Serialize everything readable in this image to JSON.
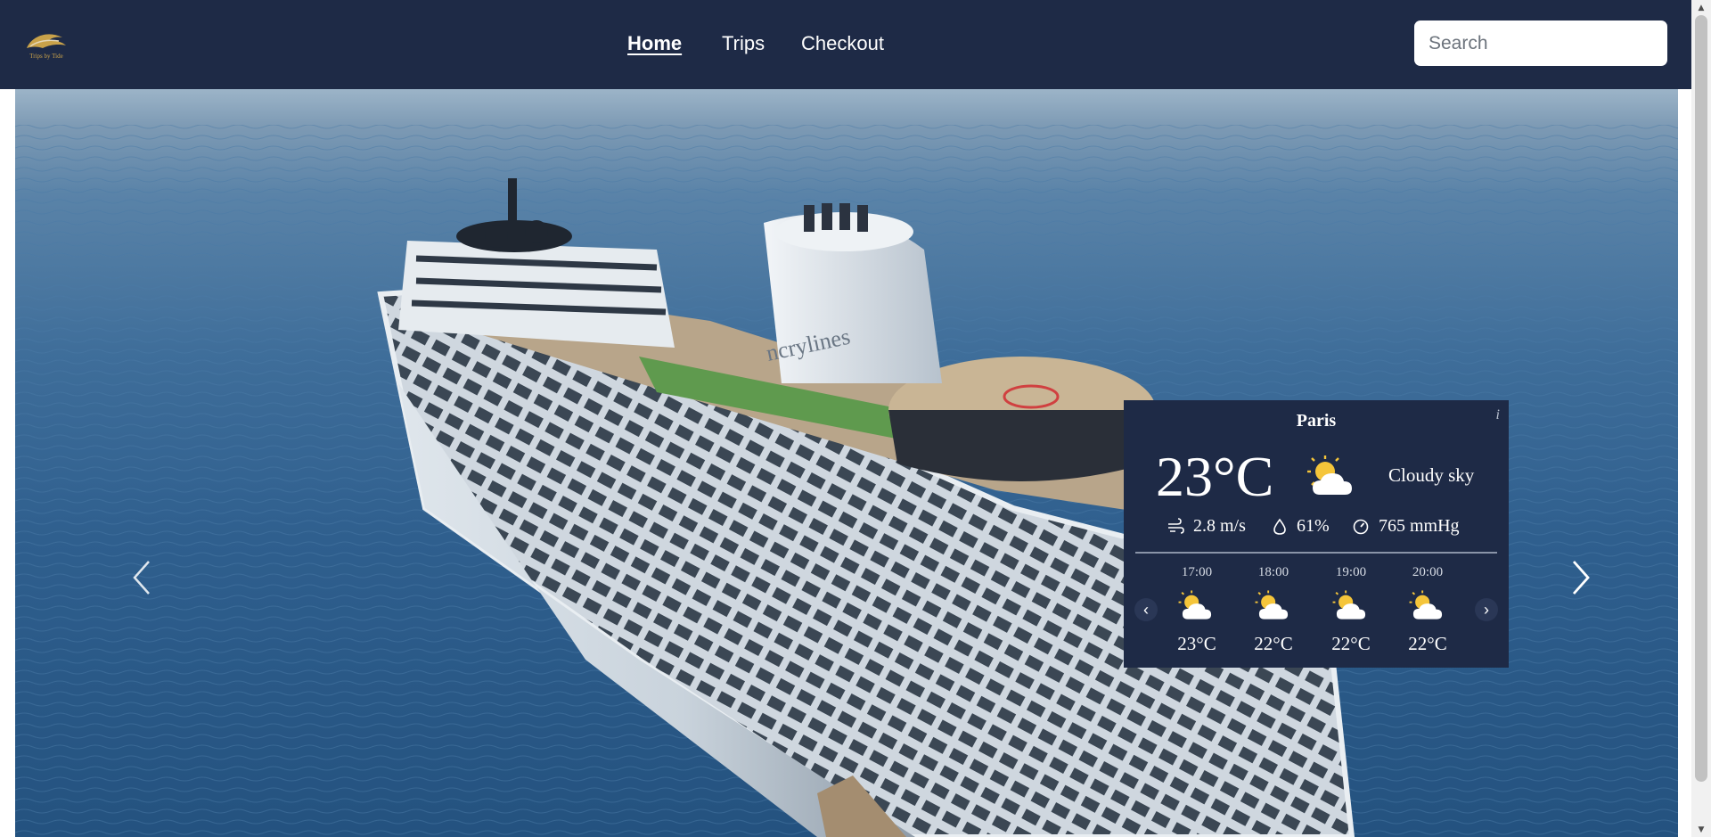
{
  "brand": {
    "logo_text": "Trips by Tide"
  },
  "nav": {
    "items": [
      {
        "label": "Home",
        "active": true
      },
      {
        "label": "Trips",
        "active": false
      },
      {
        "label": "Checkout",
        "active": false
      }
    ]
  },
  "search": {
    "placeholder": "Search",
    "value": ""
  },
  "hero": {
    "image_icon": "cruise-ship-photo",
    "ship_branding": "ncrylines",
    "prev_icon": "chevron-left-icon",
    "next_icon": "chevron-right-icon"
  },
  "weather": {
    "city": "Paris",
    "info": "i",
    "temperature": "23°C",
    "description": "Cloudy sky",
    "wind": "2.8 m/s",
    "humidity": "61%",
    "pressure": "765 mmHg",
    "hourly": [
      {
        "time": "17:00",
        "temp": "23°C",
        "icon": "partly-cloudy-icon"
      },
      {
        "time": "18:00",
        "temp": "22°C",
        "icon": "partly-cloudy-icon"
      },
      {
        "time": "19:00",
        "temp": "22°C",
        "icon": "partly-cloudy-icon"
      },
      {
        "time": "20:00",
        "temp": "22°C",
        "icon": "partly-cloudy-icon"
      }
    ],
    "scroll_left": "‹",
    "scroll_right": "›"
  },
  "colors": {
    "navbar": "#1e2a46",
    "widget": "#1e2a46",
    "sea": "#2f5f8e",
    "accent_gold": "#c9a24a"
  }
}
